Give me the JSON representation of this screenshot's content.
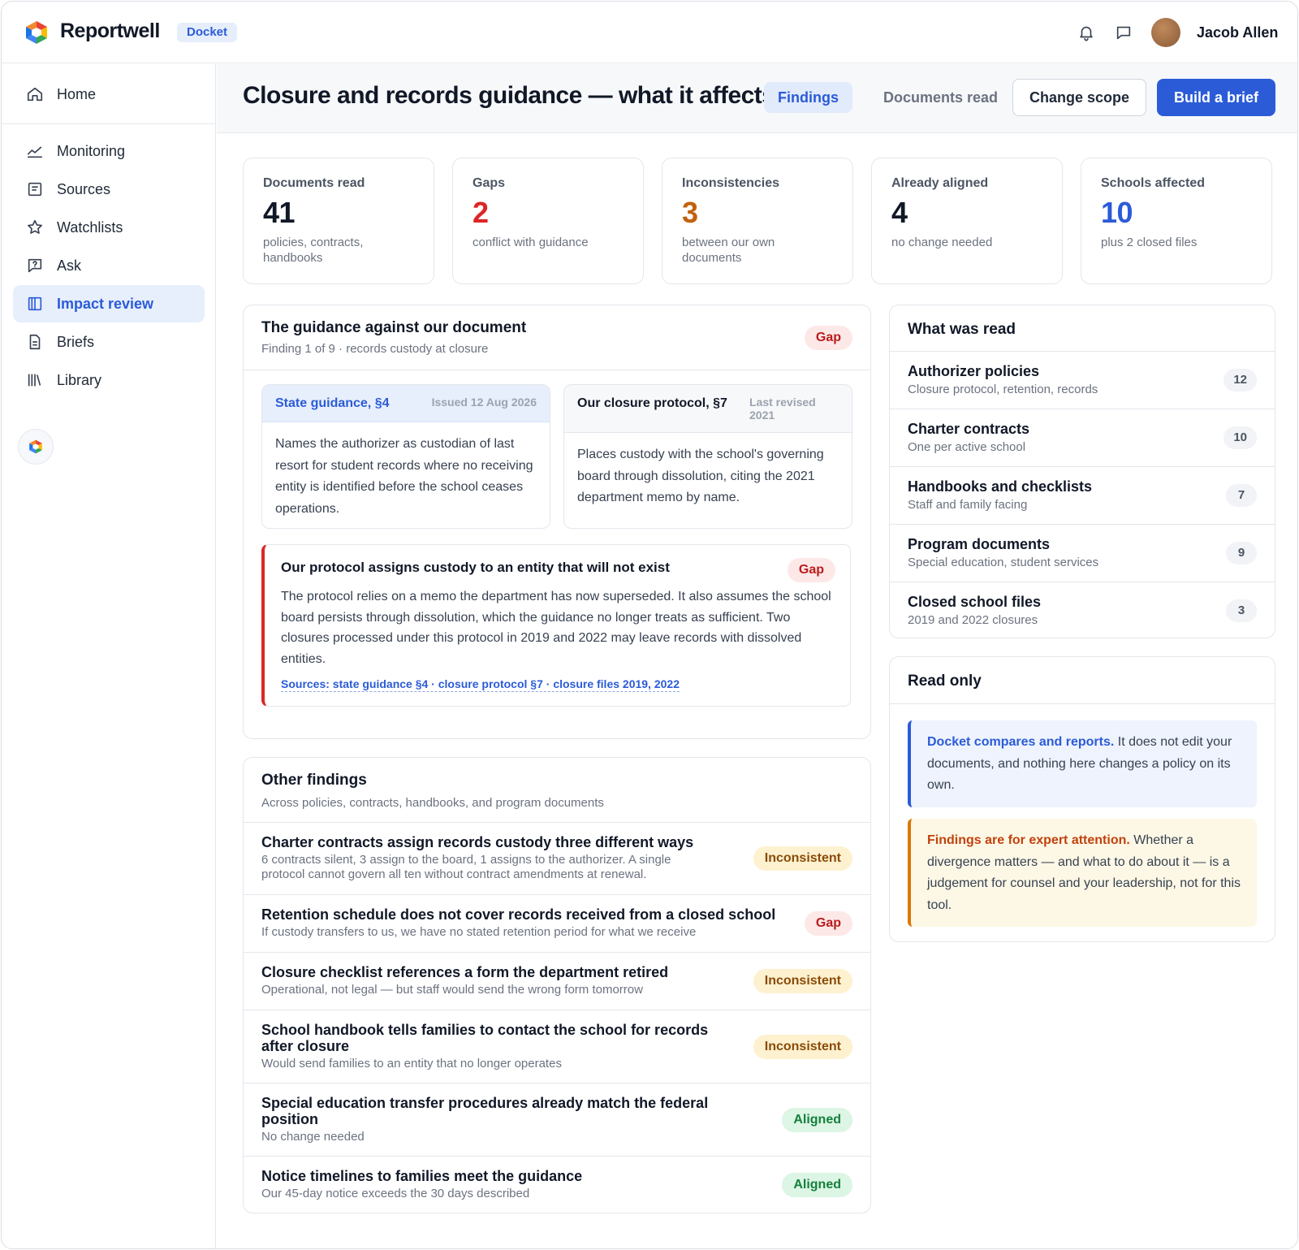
{
  "app": {
    "brand": "Reportwell",
    "product_badge": "Docket",
    "user_name": "Jacob Allen"
  },
  "colors": {
    "accent": "#2b5bd7",
    "gap": "#dc2626",
    "inconsistent": "#c2610c",
    "aligned": "#15803d"
  },
  "sidebar": {
    "items": [
      {
        "label": "Home",
        "icon": "home-icon"
      },
      {
        "label": "Monitoring",
        "icon": "chart-line-icon"
      },
      {
        "label": "Sources",
        "icon": "document-list-icon"
      },
      {
        "label": "Watchlists",
        "icon": "star-icon"
      },
      {
        "label": "Ask",
        "icon": "chat-question-icon"
      },
      {
        "label": "Impact review",
        "icon": "columns-icon",
        "active": true
      },
      {
        "label": "Briefs",
        "icon": "file-icon"
      },
      {
        "label": "Library",
        "icon": "books-icon"
      }
    ]
  },
  "header": {
    "title": "Closure and records guidance — what it affects",
    "tabs": [
      "Findings",
      "Documents read"
    ],
    "active_tab": "Findings",
    "change_scope_label": "Change scope",
    "build_brief_label": "Build a brief"
  },
  "stats": [
    {
      "label": "Documents read",
      "value": "41",
      "sub": "policies, contracts, handbooks",
      "color": "#111827"
    },
    {
      "label": "Gaps",
      "value": "2",
      "sub": "conflict with guidance",
      "color": "#dc2626"
    },
    {
      "label": "Inconsistencies",
      "value": "3",
      "sub": "between our own documents",
      "color": "#c2610c"
    },
    {
      "label": "Already aligned",
      "value": "4",
      "sub": "no change needed",
      "color": "#111827"
    },
    {
      "label": "Schools affected",
      "value": "10",
      "sub": "plus 2 closed files",
      "color": "#2b5bd7"
    }
  ],
  "comparison": {
    "title": "The guidance against our document",
    "subtitle": "Finding 1 of 9 · records custody at closure",
    "badge": "Gap",
    "guidance": {
      "title": "State guidance, §4",
      "meta": "Issued 12 Aug 2026",
      "body": "Names the authorizer as custodian of last resort for student records where no receiving entity is identified before the school ceases operations."
    },
    "ours": {
      "title": "Our closure protocol, §7",
      "meta": "Last revised 2021",
      "body": "Places custody with the school's governing board through dissolution, citing the 2021 department memo by name."
    },
    "finding": {
      "title": "Our protocol assigns custody to an entity that will not exist",
      "badge": "Gap",
      "body": "The protocol relies on a memo the department has now superseded. It also assumes the school board persists through dissolution, which the guidance no longer treats as sufficient. Two closures processed under this protocol in 2019 and 2022 may leave records with dissolved entities.",
      "sources": "Sources: state guidance §4 · closure protocol §7 · closure files 2019, 2022"
    }
  },
  "other_findings": {
    "title": "Other findings",
    "subtitle": "Across policies, contracts, handbooks, and program documents",
    "rows": [
      {
        "title": "Charter contracts assign records custody three different ways",
        "sub": "6 contracts silent, 3 assign to the board, 1 assigns to the authorizer. A single protocol cannot govern all ten without contract amendments at renewal.",
        "badge": "Inconsistent",
        "kind": "inc"
      },
      {
        "title": "Retention schedule does not cover records received from a closed school",
        "sub": "If custody transfers to us, we have no stated retention period for what we receive",
        "badge": "Gap",
        "kind": "gap"
      },
      {
        "title": "Closure checklist references a form the department retired",
        "sub": "Operational, not legal — but staff would send the wrong form tomorrow",
        "badge": "Inconsistent",
        "kind": "inc"
      },
      {
        "title": "School handbook tells families to contact the school for records after closure",
        "sub": "Would send families to an entity that no longer operates",
        "badge": "Inconsistent",
        "kind": "inc"
      },
      {
        "title": "Special education transfer procedures already match the federal position",
        "sub": "No change needed",
        "badge": "Aligned",
        "kind": "ali"
      },
      {
        "title": "Notice timelines to families meet the guidance",
        "sub": "Our 45-day notice exceeds the 30 days described",
        "badge": "Aligned",
        "kind": "ali"
      }
    ]
  },
  "what_was_read": {
    "title": "What was read",
    "rows": [
      {
        "title": "Authorizer policies",
        "sub": "Closure protocol, retention, records",
        "count": "12"
      },
      {
        "title": "Charter contracts",
        "sub": "One per active school",
        "count": "10"
      },
      {
        "title": "Handbooks and checklists",
        "sub": "Staff and family facing",
        "count": "7"
      },
      {
        "title": "Program documents",
        "sub": "Special education, student services",
        "count": "9"
      },
      {
        "title": "Closed school files",
        "sub": "2019 and 2022 closures",
        "count": "3"
      }
    ]
  },
  "read_only": {
    "title": "Read only",
    "note1_lead": "Docket compares and reports.",
    "note1_text": " It does not edit your documents, and nothing here changes a policy on its own.",
    "note2_lead": "Findings are for expert attention.",
    "note2_text": " Whether a divergence matters — and what to do about it — is a judgement for counsel and your leadership, not for this tool."
  }
}
